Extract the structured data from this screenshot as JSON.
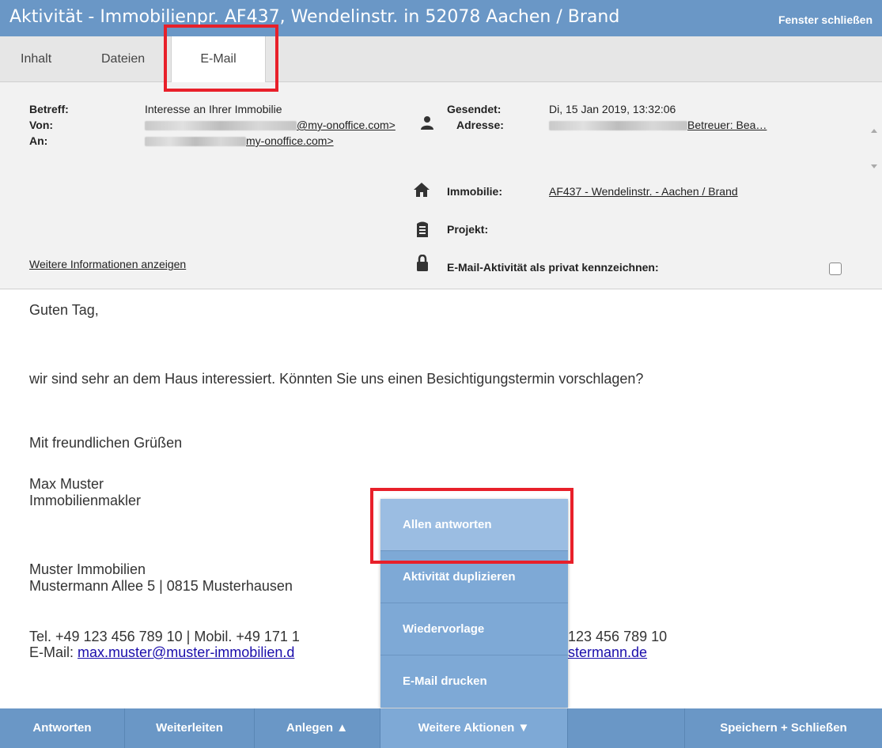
{
  "window": {
    "title": "Aktivität - Immobilienpr. AF437, Wendelinstr. in 52078 Aachen / Brand",
    "close_label": "Fenster schließen"
  },
  "tabs": [
    {
      "label": "Inhalt"
    },
    {
      "label": "Dateien"
    },
    {
      "label": "E-Mail",
      "active": true
    }
  ],
  "header": {
    "betreff_label": "Betreff:",
    "betreff_value": "Interesse an Ihrer Immobilie",
    "von_label": "Von:",
    "von_suffix": "@my-onoffice.com>",
    "an_label": "An:",
    "an_suffix": "my-onoffice.com>",
    "gesendet_label": "Gesendet:",
    "gesendet_value": "Di, 15 Jan 2019, 13:32:06",
    "adresse_label": "Adresse:",
    "adresse_value": "Betreuer: Bea…",
    "immobilie_label": "Immobilie:",
    "immobilie_value": "AF437 - Wendelinstr. - Aachen / Brand",
    "projekt_label": "Projekt:",
    "privat_label": "E-Mail-Aktivität als privat kennzeichnen:",
    "privat_checked": false,
    "more_info_link": "Weitere Informationen anzeigen"
  },
  "body": {
    "greeting": "Guten Tag,",
    "paragraph": "wir sind sehr an dem Haus interessiert. Könnten Sie uns einen Besichtigungstermin vorschlagen?",
    "closing": "Mit freundlichen Grüßen",
    "name": "Max Muster",
    "role": "Immobilienmakler",
    "company": "Muster Immobilien",
    "address": "Mustermann Allee 5 | 0815 Musterhausen",
    "phone_left": "Tel. +49 123 456 789 10 | Mobil. +49 171 1",
    "phone_right": "123 456 789 10",
    "email_prefix": "E-Mail: ",
    "email_link": "max.muster@muster-immobilien.d",
    "web_link": "stermann.de"
  },
  "menu": {
    "items": [
      {
        "label": "Allen antworten"
      },
      {
        "label": "Aktivität duplizieren"
      },
      {
        "label": "Wiedervorlage"
      },
      {
        "label": "E-Mail drucken"
      }
    ]
  },
  "bottom": {
    "antworten": "Antworten",
    "weiterleiten": "Weiterleiten",
    "anlegen": "Anlegen ▲",
    "weitere": "Weitere Aktionen ▼",
    "speichern": "Speichern + Schließen"
  },
  "colors": {
    "bar": "#6a97c6",
    "menu": "#7ea9d6",
    "annotation": "#e8202a"
  }
}
